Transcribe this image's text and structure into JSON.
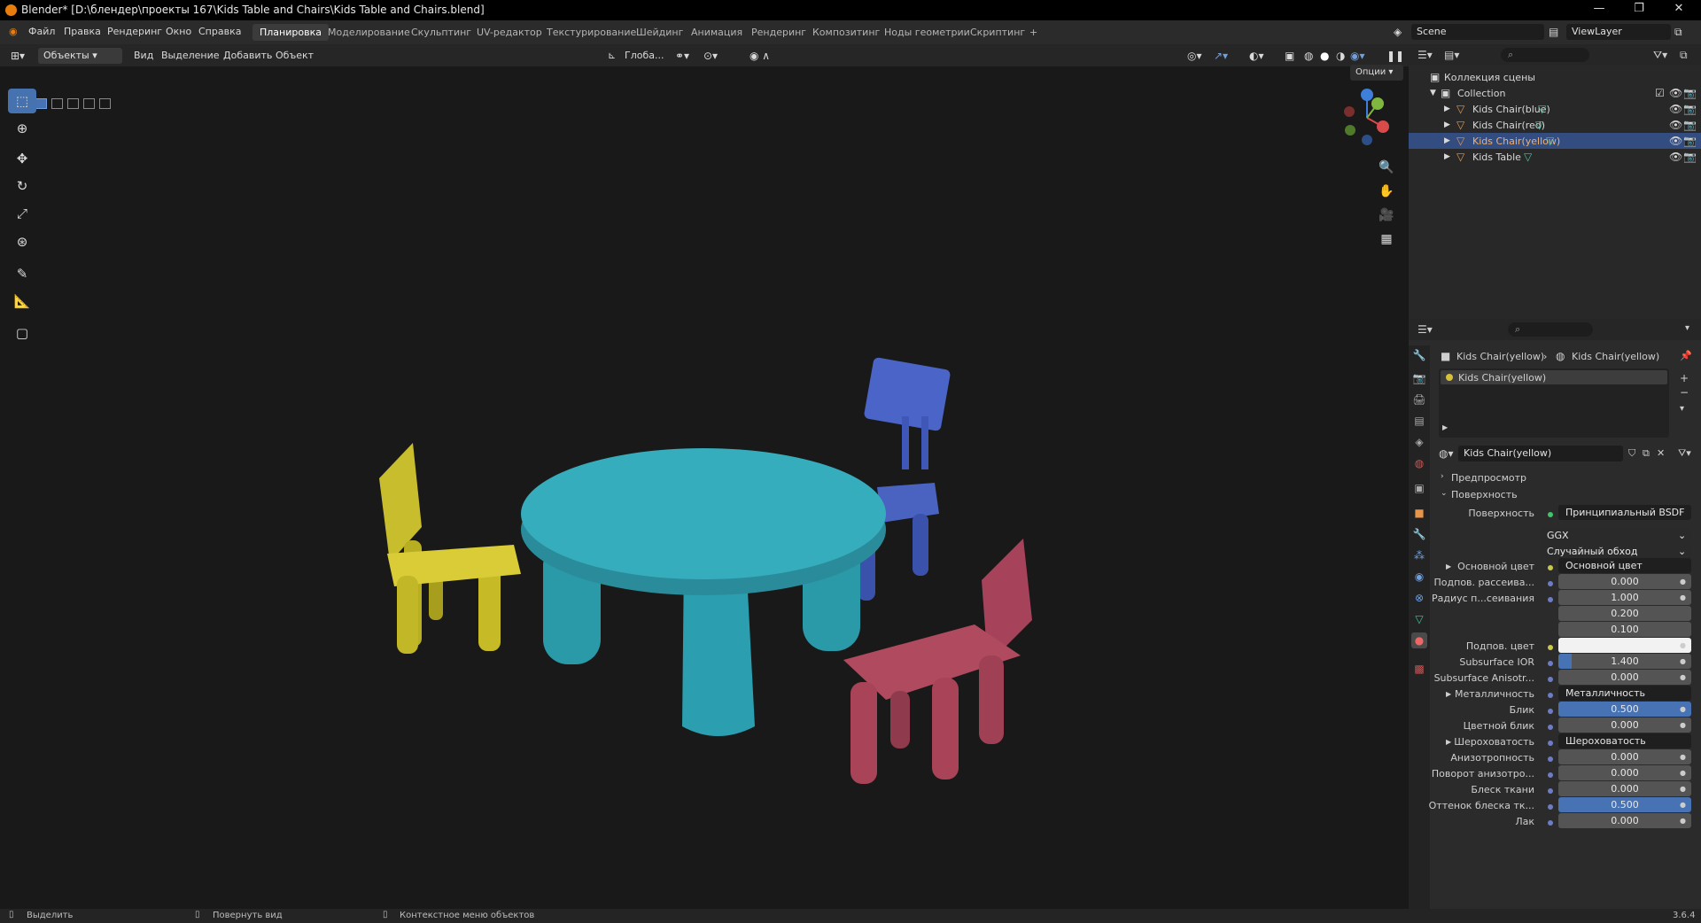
{
  "title": "Blender* [D:\\блендер\\проекты 167\\Kids Table and Chairs\\Kids Table and Chairs.blend]",
  "menus": [
    "Файл",
    "Правка",
    "Рендеринг",
    "Окно",
    "Справка"
  ],
  "workspaces": [
    "Планировка",
    "Моделирование",
    "Скульптинг",
    "UV-редактор",
    "Текстурирование",
    "Шейдинг",
    "Анимация",
    "Рендеринг",
    "Композитинг",
    "Ноды геометрии",
    "Скриптинг",
    "+"
  ],
  "scene": "Scene",
  "view_layer": "ViewLayer",
  "viewport": {
    "mode": "Объекты",
    "menus": [
      "Вид",
      "Выделение",
      "Добавить",
      "Объект"
    ],
    "orientation": "Глоба...",
    "options": "Опции"
  },
  "outliner": {
    "root": "Коллекция сцены",
    "collection": "Collection",
    "objects": [
      "Kids Chair(blue)",
      "Kids Chair(red)",
      "Kids Chair(yellow)",
      "Kids Table"
    ]
  },
  "props": {
    "breadcrumb_obj": "Kids Chair(yellow)",
    "breadcrumb_mat": "Kids Chair(yellow)",
    "slot": "Kids Chair(yellow)",
    "material": "Kids Chair(yellow)",
    "preview": "Предпросмотр",
    "surface_panel": "Поверхность",
    "rows": [
      {
        "label": "Поверхность",
        "value": "Принципиальный BSDF"
      },
      {
        "label": "",
        "value": "GGX"
      },
      {
        "label": "",
        "value": "Случайный обход"
      },
      {
        "label": "Основной цвет",
        "value": "Основной цвет"
      },
      {
        "label": "Подпов. рассеива...",
        "value": "0.000"
      },
      {
        "label": "Радиус п...сеивания",
        "value": "1.000"
      },
      {
        "label": "",
        "value": "0.200"
      },
      {
        "label": "",
        "value": "0.100"
      },
      {
        "label": "Подпов. цвет",
        "value": ""
      },
      {
        "label": "Subsurface IOR",
        "value": "1.400"
      },
      {
        "label": "Subsurface Anisotr...",
        "value": "0.000"
      },
      {
        "label": "Металличность",
        "value": "Металличность"
      },
      {
        "label": "Блик",
        "value": "0.500"
      },
      {
        "label": "Цветной блик",
        "value": "0.000"
      },
      {
        "label": "Шероховатость",
        "value": "Шероховатость"
      },
      {
        "label": "Анизотропность",
        "value": "0.000"
      },
      {
        "label": "Поворот анизотро...",
        "value": "0.000"
      },
      {
        "label": "Блеск ткани",
        "value": "0.000"
      },
      {
        "label": "Оттенок блеска тк...",
        "value": "0.500"
      },
      {
        "label": "Лак",
        "value": "0.000"
      }
    ]
  },
  "status": {
    "select": "Выделить",
    "rotate": "Повернуть вид",
    "context": "Контекстное меню объектов",
    "version": "3.6.4"
  }
}
